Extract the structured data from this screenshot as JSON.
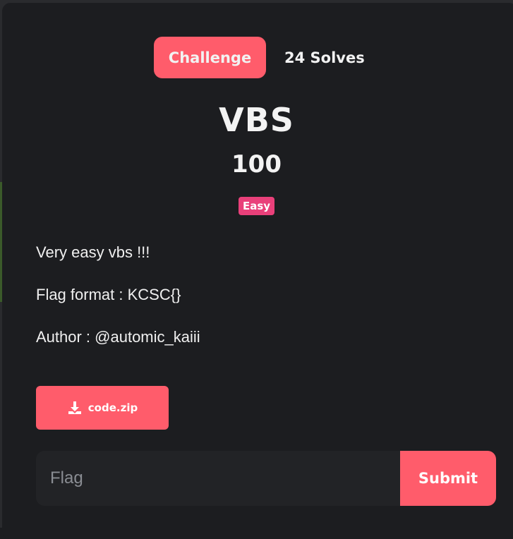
{
  "tabs": {
    "challenge_label": "Challenge",
    "solves_label": "24 Solves"
  },
  "challenge": {
    "name": "VBS",
    "points": "100",
    "difficulty": "Easy",
    "description": [
      "Very easy vbs !!!",
      "Flag format : KCSC{}",
      "Author : @automic_kaiii"
    ]
  },
  "attachment": {
    "label": "code.zip",
    "icon": "download-icon"
  },
  "flag_form": {
    "placeholder": "Flag",
    "value": "",
    "submit_label": "Submit"
  },
  "colors": {
    "accent": "#ff5c6b",
    "badge": "#e9407a",
    "background": "#1c1d20",
    "input_bg": "#222326"
  }
}
